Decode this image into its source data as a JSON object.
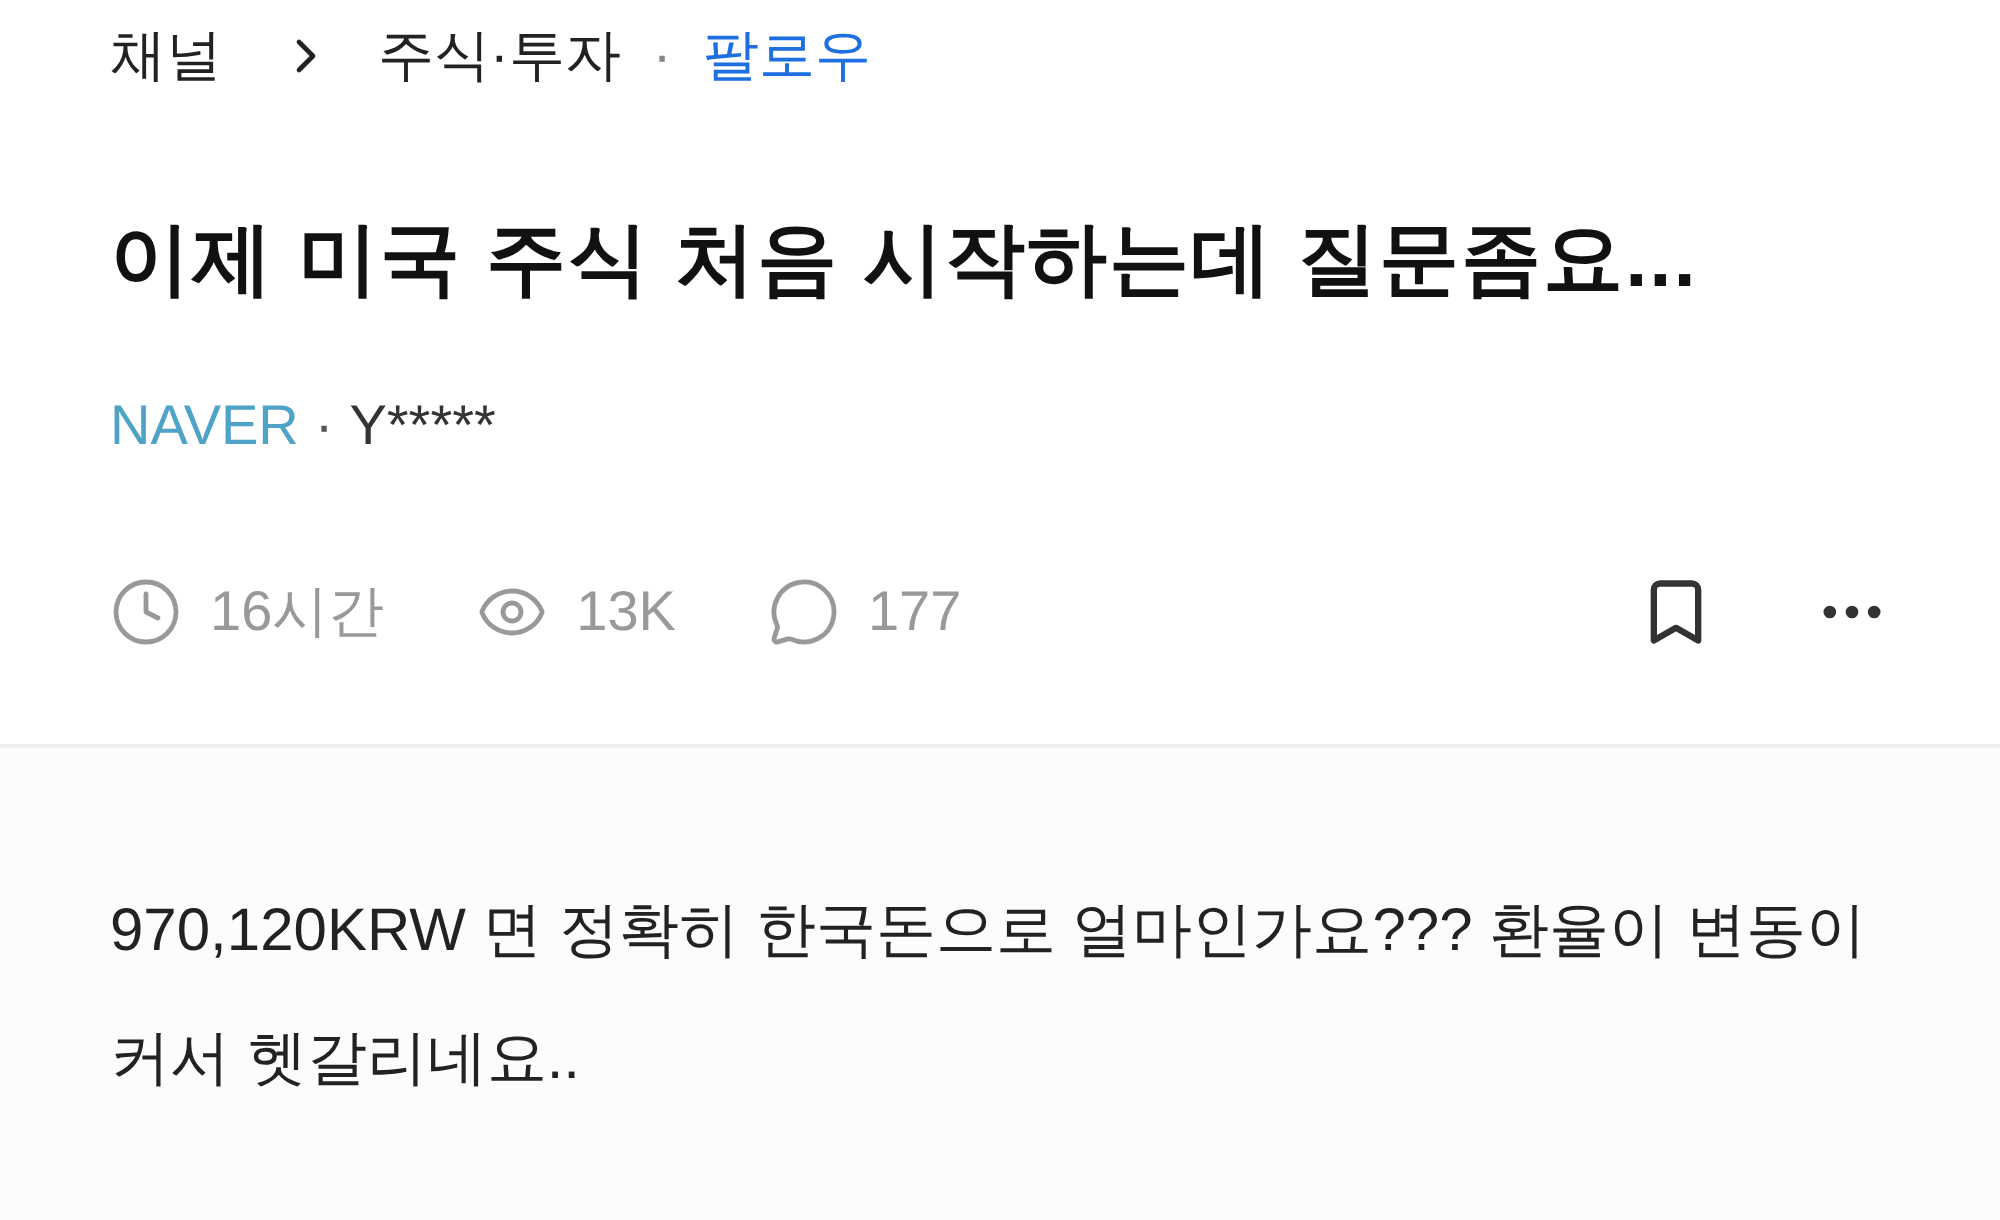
{
  "breadcrumb": {
    "root": "채널",
    "category": "주식·투자",
    "separator": "·",
    "follow": "팔로우"
  },
  "title": "이제 미국 주식 처음 시작하는데 질문좀요...",
  "source": {
    "name": "NAVER",
    "separator": "·",
    "author": "Y*****"
  },
  "stats": [
    {
      "kind": "time",
      "text": "16시간"
    },
    {
      "kind": "views",
      "text": "13K"
    },
    {
      "kind": "comments",
      "text": "177"
    }
  ],
  "actions": [
    {
      "kind": "bookmark"
    },
    {
      "kind": "more"
    }
  ],
  "body": "970,120KRW 면 정확히 한국돈으로 얼마인가요??? 환율이 변동이 커서 헷갈리네요.."
}
